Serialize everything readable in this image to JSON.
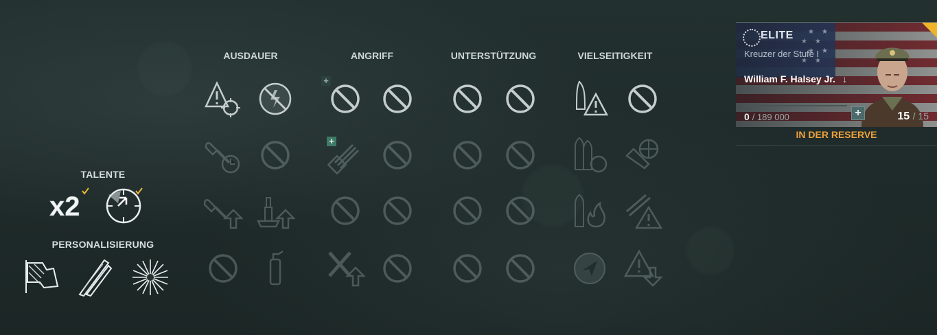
{
  "left": {
    "talents_title": "TALENTE",
    "personalization_title": "PERSONALISIERUNG",
    "talent_icons": [
      "x2-multiplier-icon",
      "dispersion-target-icon"
    ],
    "personalization_icons": [
      "flag-icon",
      "camouflage-brush-icon",
      "fireworks-icon"
    ],
    "x2_text": "x2"
  },
  "skills": {
    "columns": [
      {
        "label": "AUSDAUER"
      },
      {
        "label": "ANGRIFF"
      },
      {
        "label": "UNTERSTÜTZUNG"
      },
      {
        "label": "VIELSEITIGKEIT"
      }
    ]
  },
  "commander": {
    "elite": "ELITE",
    "rank": "Kreuzer der Stufe I",
    "name": "William F. Halsey Jr.",
    "xp_current": "0",
    "xp_max": "/ 189 000",
    "points_current": "15",
    "points_max": "/ 15",
    "status": "IN DER RESERVE"
  },
  "colors": {
    "accent_orange": "#f0a23a",
    "corner_yellow": "#f0b429",
    "plus_green": "#3f7a66"
  }
}
